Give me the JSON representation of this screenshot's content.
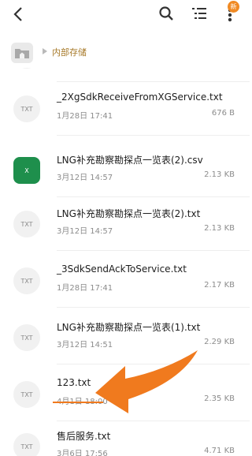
{
  "toolbar": {
    "back_icon": "back-arrow-icon",
    "search_icon": "search-icon",
    "sort_icon": "sort-list-icon",
    "more_icon": "more-vertical-icon",
    "badge": "新"
  },
  "breadcrumb": {
    "home_icon": "folder-home-icon",
    "label": "内部存储"
  },
  "files": [
    {
      "name": "_2XgSdkReceiveFromXGService.txt",
      "date": "1月28日  17:41",
      "size": "676 B",
      "type": "TXT"
    },
    {
      "name": "LNG补充勘察勘探点一览表(2).csv",
      "date": "3月12日  14:57",
      "size": "2.13 KB",
      "type": "X"
    },
    {
      "name": "LNG补充勘察勘探点一览表(2).txt",
      "date": "3月12日  14:57",
      "size": "2.13 KB",
      "type": "TXT"
    },
    {
      "name": "_3SdkSendAckToService.txt",
      "date": "1月28日  17:41",
      "size": "2.17 KB",
      "type": "TXT"
    },
    {
      "name": "LNG补充勘察勘探点一览表(1).txt",
      "date": "3月12日  14:51",
      "size": "2.29 KB",
      "type": "TXT"
    },
    {
      "name": "123.txt",
      "date": "4月1日  18:00",
      "size": "2.35 KB",
      "type": "TXT"
    },
    {
      "name": "售后服务.txt",
      "date": "3月6日  17:56",
      "size": "4.71 KB",
      "type": "TXT"
    }
  ],
  "colors": {
    "accent": "#f07a1e",
    "excel_green": "#1e8f4c",
    "breadcrumb_text": "#a77a2a"
  }
}
